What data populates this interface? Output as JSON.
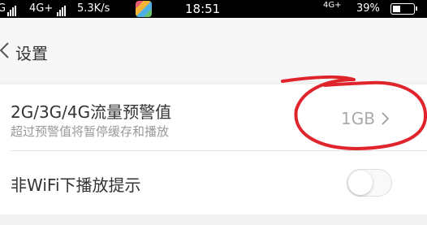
{
  "status_bar": {
    "signal_left": "G",
    "network1": "4G+",
    "speed": "5.3K/s",
    "time": "18:51",
    "network2": "4G+",
    "battery": "39%"
  },
  "nav": {
    "title": "设置"
  },
  "settings": {
    "data_warning": {
      "title": "2G/3G/4G流量预警值",
      "subtitle": "超过预警值将暂停缓存和播放",
      "value": "1GB"
    },
    "non_wifi": {
      "title": "非WiFi下播放提示",
      "toggle_on": false
    }
  },
  "colors": {
    "annotation": "#e0242b"
  }
}
